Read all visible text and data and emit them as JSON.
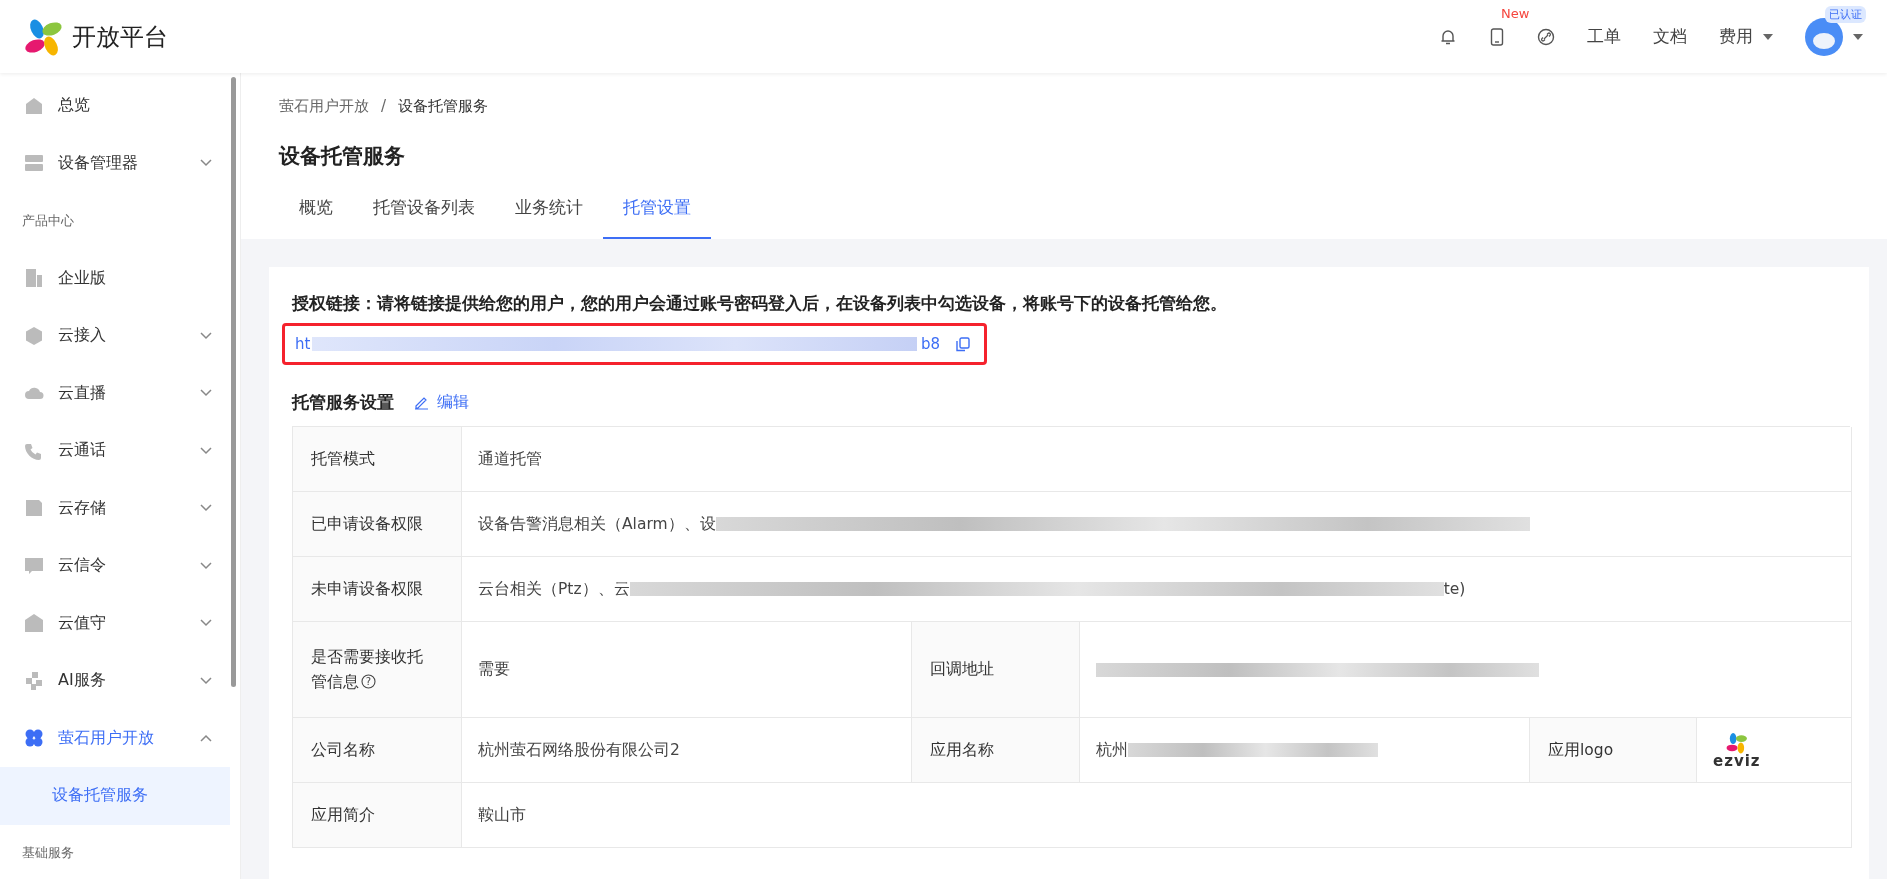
{
  "header": {
    "brand": "开放平台",
    "new_badge": "New",
    "links": [
      "工单",
      "文档"
    ],
    "fee_menu": "费用",
    "verified_badge": "已认证"
  },
  "sidebar": {
    "items": [
      {
        "kind": "item",
        "label": "总览",
        "selected": false
      },
      {
        "kind": "item",
        "label": "设备管理器",
        "expanded": false,
        "selected": false
      },
      {
        "kind": "section",
        "label": "产品中心"
      },
      {
        "kind": "item",
        "label": "企业版",
        "selected": false
      },
      {
        "kind": "item",
        "label": "云接入",
        "expanded": false,
        "selected": false
      },
      {
        "kind": "item",
        "label": "云直播",
        "expanded": false,
        "selected": false
      },
      {
        "kind": "item",
        "label": "云通话",
        "expanded": false,
        "selected": false
      },
      {
        "kind": "item",
        "label": "云存储",
        "expanded": false,
        "selected": false
      },
      {
        "kind": "item",
        "label": "云信令",
        "expanded": false,
        "selected": false
      },
      {
        "kind": "item",
        "label": "云值守",
        "expanded": false,
        "selected": false
      },
      {
        "kind": "item",
        "label": "AI服务",
        "expanded": false,
        "selected": false
      },
      {
        "kind": "item",
        "label": "萤石用户开放",
        "expanded": true,
        "selected": true
      },
      {
        "kind": "sub",
        "label": "设备托管服务",
        "selected": true
      },
      {
        "kind": "section",
        "label": "基础服务"
      }
    ]
  },
  "breadcrumb": [
    "萤石用户开放",
    "设备托管服务"
  ],
  "breadcrumb_separator": "/",
  "page_title": "设备托管服务",
  "tabs": [
    {
      "label": "概览",
      "selected": false
    },
    {
      "label": "托管设备列表",
      "selected": false
    },
    {
      "label": "业务统计",
      "selected": false
    },
    {
      "label": "托管设置",
      "selected": true
    }
  ],
  "auth_link": {
    "heading": "授权链接：请将链接提供给您的用户，您的用户会通过账号密码登入后，在设备列表中勾选设备，将账号下的设备托管给您。",
    "url_start": "ht",
    "url_end": "b8"
  },
  "settings": {
    "title": "托管服务设置",
    "edit": "编辑",
    "rows": [
      [
        {
          "label": "托管模式",
          "value": "通道托管",
          "redacted": false
        }
      ],
      [
        {
          "label": "已申请设备权限",
          "value": "设备告警消息相关（Alarm）、设",
          "redacted": true
        }
      ],
      [
        {
          "label": "未申请设备权限",
          "value": "云台相关（Ptz）、云",
          "value_end": "te)",
          "redacted": true
        }
      ],
      [
        {
          "label": "是否需要接收托管信息",
          "help": "?",
          "value": "需要",
          "redacted": false
        },
        {
          "label": "回调地址",
          "redacted": true
        }
      ],
      [
        {
          "label": "公司名称",
          "value": "杭州萤石网络股份有限公司2",
          "redacted": false
        },
        {
          "label": "应用名称",
          "value": "杭州",
          "redacted": true
        },
        {
          "label": "应用logo",
          "kind": "logo",
          "logo_text": "ezviz"
        }
      ],
      [
        {
          "label": "应用简介",
          "value": "鞍山市",
          "redacted": false
        }
      ]
    ]
  }
}
